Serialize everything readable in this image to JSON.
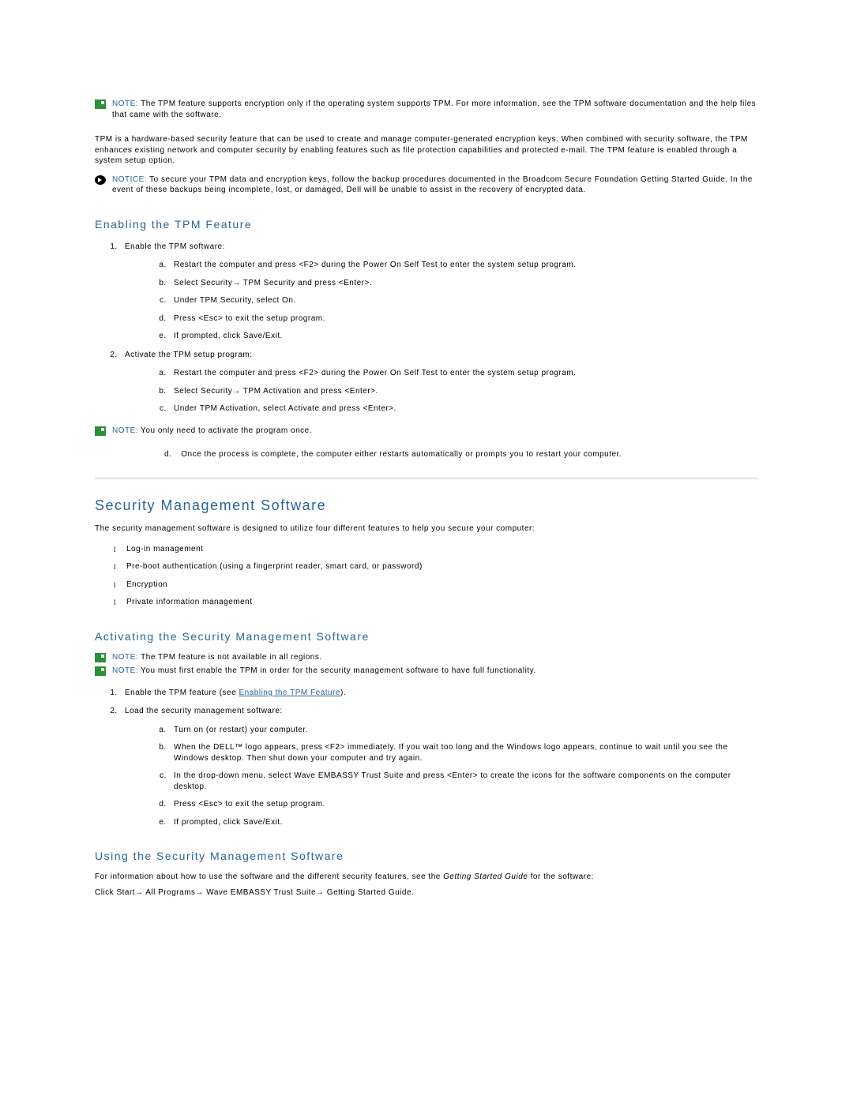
{
  "note1": {
    "label": "NOTE:",
    "text": "The TPM feature supports encryption only if the operating system supports TPM. For more information, see the TPM software documentation and the help files that came with the software."
  },
  "intro_para": "TPM is a hardware-based security feature that can be used to create and manage computer-generated encryption keys. When combined with security software, the TPM enhances existing network and computer security by enabling features such as file protection capabilities and protected e-mail. The TPM feature is enabled through a system setup option.",
  "notice1": {
    "label": "NOTICE:",
    "text": "To secure your TPM data and encryption keys, follow the backup procedures documented in the Broadcom Secure Foundation Getting Started Guide. In the event of these backups being incomplete, lost, or damaged, Dell will be unable to assist in the recovery of encrypted data."
  },
  "h3_enable": "Enabling the TPM Feature",
  "step1_lead": "Enable the TPM software:",
  "step1": {
    "a": "Restart the computer and press <F2> during the Power On Self Test to enter the system setup program.",
    "b": "Select Security→ TPM Security and press <Enter>.",
    "c": "Under TPM Security, select On.",
    "d": "Press <Esc> to exit the setup program.",
    "e": "If prompted, click Save/Exit."
  },
  "step2_lead": "Activate the TPM setup program:",
  "step2": {
    "a": "Restart the computer and press <F2> during the Power On Self Test to enter the system setup program.",
    "b": "Select Security→ TPM Activation and press <Enter>.",
    "c": "Under TPM Activation, select Activate and press <Enter>."
  },
  "note2": {
    "label": "NOTE:",
    "text": "You only need to activate the program once."
  },
  "step2d": "Once the process is complete, the computer either restarts automatically or prompts you to restart your computer.",
  "h2_sms": "Security Management Software",
  "sms_intro": "The security management software is designed to utilize four different features to help you secure your computer:",
  "sms_features": {
    "a": "Log-in management",
    "b": "Pre-boot authentication (using a fingerprint reader, smart card, or password)",
    "c": "Encryption",
    "d": "Private information management"
  },
  "h3_activate": "Activating the Security Management Software",
  "note3": {
    "label": "NOTE:",
    "text": "The TPM feature is not available in all regions."
  },
  "note4": {
    "label": "NOTE:",
    "text": "You must first enable the TPM in order for the security management software to have full functionality."
  },
  "act_step1_pre": "Enable the TPM feature (see ",
  "act_step1_link": "Enabling the TPM Feature",
  "act_step1_post": ").",
  "act_step2_lead": "Load the security management software:",
  "act_step2": {
    "a": "Turn on (or restart) your computer.",
    "b": "When the DELL™ logo appears, press <F2> immediately. If you wait too long and the Windows logo appears, continue to wait until you see the Windows desktop. Then shut down your computer and try again.",
    "c": "In the drop-down menu, select Wave EMBASSY Trust Suite and press <Enter> to create the icons for the software components on the computer desktop.",
    "d": "Press <Esc> to exit the setup program.",
    "e": "If prompted, click Save/Exit."
  },
  "h3_using": "Using the Security Management Software",
  "using_p1_pre": "For information about how to use the software and the different security features, see the ",
  "using_p1_italic": "Getting Started Guide",
  "using_p1_post": " for the software:",
  "using_p2": "Click Start→ All Programs→ Wave EMBASSY Trust Suite→ Getting Started Guide."
}
